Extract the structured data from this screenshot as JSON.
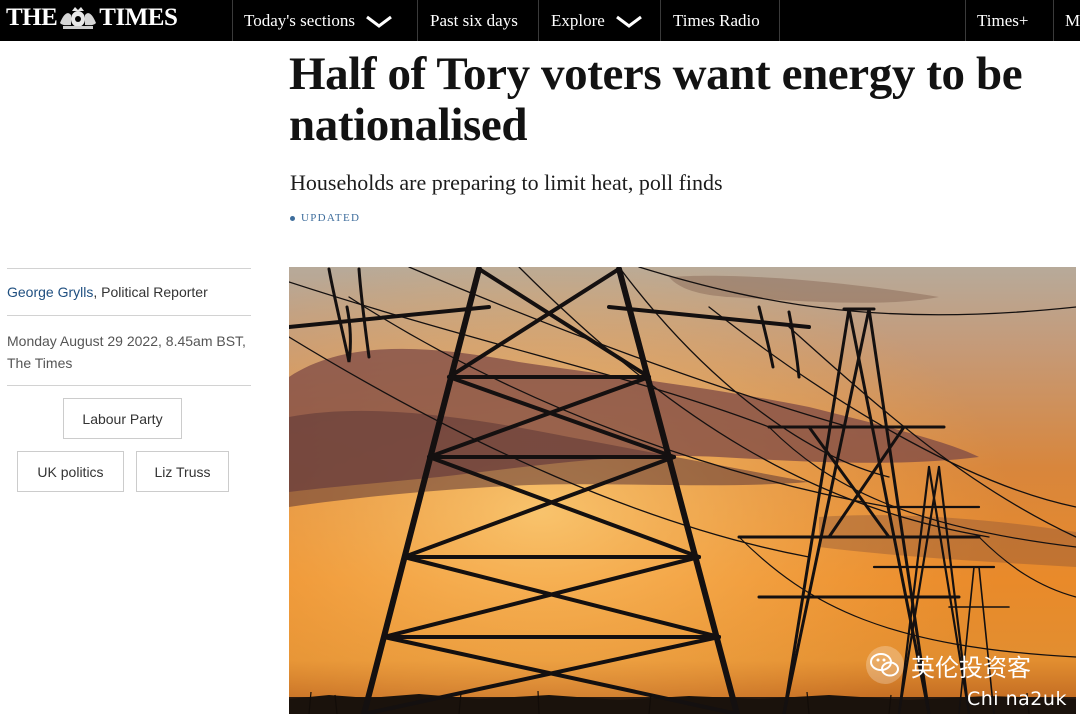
{
  "header": {
    "brand_left": "THE",
    "brand_right": "TIMES",
    "crest_icon": "royal-crest-icon",
    "nav": [
      {
        "label": "Today's sections",
        "has_dropdown": true
      },
      {
        "label": "Past six days",
        "has_dropdown": false
      },
      {
        "label": "Explore",
        "has_dropdown": true
      },
      {
        "label": "Times Radio",
        "has_dropdown": false
      },
      {
        "label": "Times+",
        "has_dropdown": false
      },
      {
        "label": "M",
        "has_dropdown": false
      }
    ],
    "colors": {
      "background": "#000000",
      "text": "#ffffff"
    }
  },
  "article": {
    "headline": "Half of Tory voters want energy to be nationalised",
    "subheadline": "Households are preparing to limit heat, poll finds",
    "status": "UPDATED",
    "author": "George Grylls",
    "author_role": ", Political Reporter",
    "dateline": "Monday August 29 2022, 8.45am BST, The Times",
    "tags": [
      "Labour Party",
      "UK politics",
      "Liz Truss"
    ],
    "hero_image": "electricity-pylons-at-sunset",
    "colors": {
      "link": "#1f4f80",
      "status": "#3e6d9c"
    }
  },
  "watermark": {
    "icon": "wechat-icon",
    "title": "英伦投资客",
    "subtitle": "Chi na2uk"
  }
}
